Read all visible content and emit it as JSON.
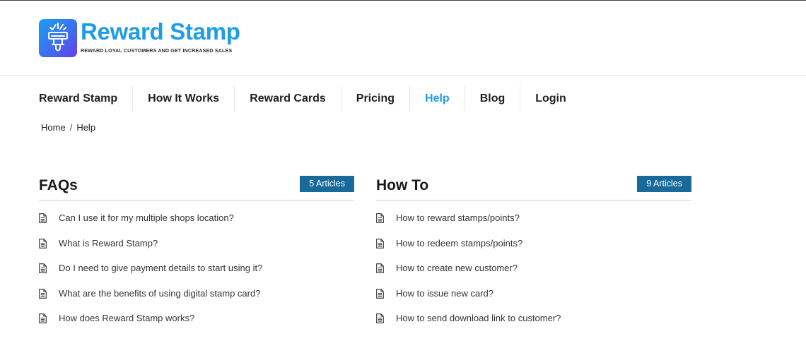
{
  "brand": {
    "title": "Reward Stamp",
    "tagline": "REWARD LOYAL CUSTOMERS AND GET INCREASED SALES",
    "icon": "stamp-logo-icon"
  },
  "nav": {
    "items": [
      {
        "label": "Reward Stamp",
        "active": false
      },
      {
        "label": "How It Works",
        "active": false
      },
      {
        "label": "Reward Cards",
        "active": false
      },
      {
        "label": "Pricing",
        "active": false
      },
      {
        "label": "Help",
        "active": true
      },
      {
        "label": "Blog",
        "active": false
      },
      {
        "label": "Login",
        "active": false
      }
    ]
  },
  "breadcrumb": {
    "home": "Home",
    "separator": "/",
    "current": "Help"
  },
  "sections": {
    "faqs": {
      "title": "FAQs",
      "badge": "5 Articles",
      "articles": [
        "Can I use it for my multiple shops location?",
        "What is Reward Stamp?",
        "Do I need to give payment details to start using it?",
        "What are the benefits of using digital stamp card?",
        "How does Reward Stamp works?"
      ]
    },
    "howto": {
      "title": "How To",
      "badge": "9 Articles",
      "articles": [
        "How to reward stamps/points?",
        "How to redeem stamps/points?",
        "How to create new customer?",
        "How to issue new card?",
        "How to send download link to customer?"
      ]
    }
  },
  "colors": {
    "accent": "#1e9de6",
    "badge": "#176a99",
    "logo_gradient": [
      "#1aa0f0",
      "#6a3ee8"
    ]
  }
}
